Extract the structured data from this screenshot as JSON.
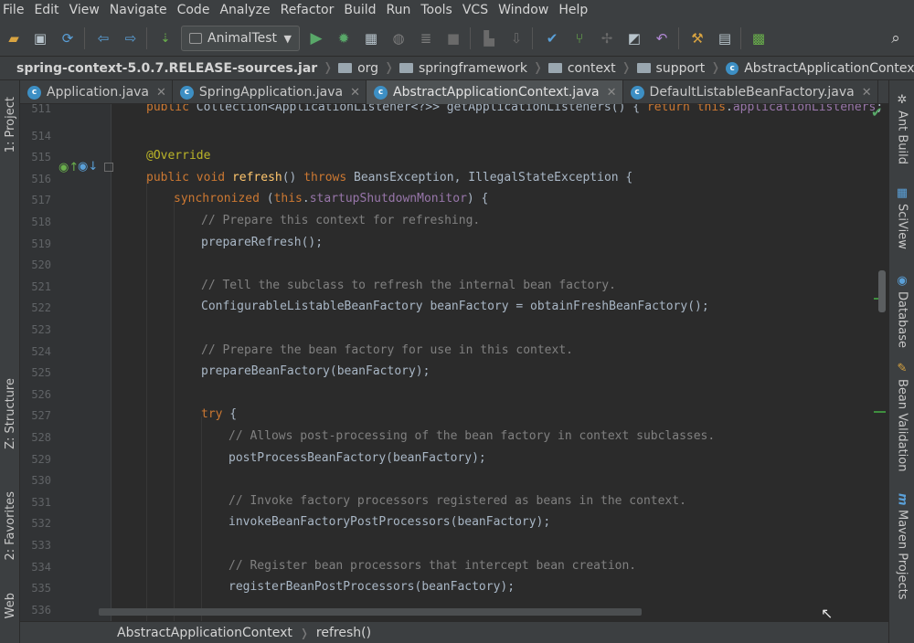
{
  "menu": [
    "File",
    "Edit",
    "View",
    "Navigate",
    "Code",
    "Analyze",
    "Refactor",
    "Build",
    "Run",
    "Tools",
    "VCS",
    "Window",
    "Help"
  ],
  "toolbar": {
    "run_config": "AnimalTest"
  },
  "nav": {
    "jar": "spring-context-5.0.7.RELEASE-sources.jar",
    "packages": [
      "org",
      "springframework",
      "context",
      "support"
    ],
    "class_name": "AbstractApplicationContext"
  },
  "tabs": [
    {
      "label": "Application.java",
      "active": false
    },
    {
      "label": "SpringApplication.java",
      "active": false
    },
    {
      "label": "AbstractApplicationContext.java",
      "active": true
    },
    {
      "label": "DefaultListableBeanFactory.java",
      "active": false
    }
  ],
  "left_tools": {
    "project": "1: Project",
    "structure": "Z: Structure",
    "favorites": "2: Favorites",
    "web": "Web"
  },
  "right_tools": {
    "ant": "Ant Build",
    "sciview": "SciView",
    "database": "Database",
    "bean_validation": "Bean Validation",
    "maven": "Maven Projects"
  },
  "editor": {
    "lines": [
      {
        "num": "511",
        "text": "public Collection<ApplicationListener<?>> getApplicationListeners() { return this.applicationListeners; }"
      },
      {
        "num": "514",
        "text": ""
      },
      {
        "num": "515",
        "text": "@Override"
      },
      {
        "num": "516",
        "text": "public void refresh() throws BeansException, IllegalStateException {"
      },
      {
        "num": "517",
        "text": "synchronized (this.startupShutdownMonitor) {"
      },
      {
        "num": "518",
        "text": "// Prepare this context for refreshing."
      },
      {
        "num": "519",
        "text": "prepareRefresh();"
      },
      {
        "num": "520",
        "text": ""
      },
      {
        "num": "521",
        "text": "// Tell the subclass to refresh the internal bean factory."
      },
      {
        "num": "522",
        "text": "ConfigurableListableBeanFactory beanFactory = obtainFreshBeanFactory();"
      },
      {
        "num": "523",
        "text": ""
      },
      {
        "num": "524",
        "text": "// Prepare the bean factory for use in this context."
      },
      {
        "num": "525",
        "text": "prepareBeanFactory(beanFactory);"
      },
      {
        "num": "526",
        "text": ""
      },
      {
        "num": "527",
        "text": "try {"
      },
      {
        "num": "528",
        "text": "// Allows post-processing of the bean factory in context subclasses."
      },
      {
        "num": "529",
        "text": "postProcessBeanFactory(beanFactory);"
      },
      {
        "num": "530",
        "text": ""
      },
      {
        "num": "531",
        "text": "// Invoke factory processors registered as beans in the context."
      },
      {
        "num": "532",
        "text": "invokeBeanFactoryPostProcessors(beanFactory);"
      },
      {
        "num": "533",
        "text": ""
      },
      {
        "num": "534",
        "text": "// Register bean processors that intercept bean creation."
      },
      {
        "num": "535",
        "text": "registerBeanPostProcessors(beanFactory);"
      },
      {
        "num": "536",
        "text": ""
      }
    ]
  },
  "status_breadcrumb": {
    "class_name": "AbstractApplicationContext",
    "method": "refresh()"
  },
  "colors": {
    "background": "#2b2b2b",
    "keyword": "#cc7832",
    "comment": "#808080",
    "annotation": "#bbb529",
    "method_decl": "#ffc66d",
    "field": "#9876aa",
    "text": "#a9b7c6"
  }
}
